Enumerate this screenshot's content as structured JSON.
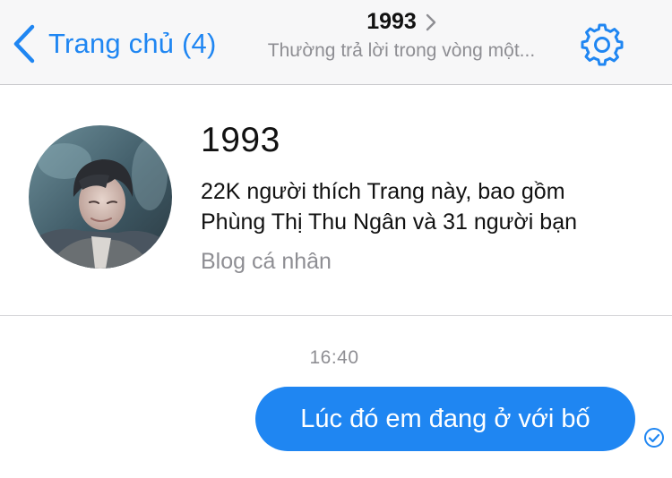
{
  "navbar": {
    "back_label": "Trang chủ (4)",
    "title": "1993",
    "subtitle": "Thường trả lời trong vòng một...",
    "icons": {
      "back": "chevron-left-icon",
      "title_chevron": "chevron-right-icon",
      "settings": "gear-icon"
    }
  },
  "page_card": {
    "name": "1993",
    "likes_line1": "22K người thích Trang này, bao gồm",
    "likes_line2": "Phùng Thị Thu Ngân và 31 người bạn",
    "category": "Blog cá nhân"
  },
  "conversation": {
    "timestamp": "16:40",
    "messages": [
      {
        "text": "Lúc đó em đang ở với bố",
        "sender": "me",
        "status_icon": "seen-check-icon"
      }
    ]
  },
  "colors": {
    "accent": "#1f86f2",
    "nav_background": "#f7f7f8",
    "secondary_text": "#8e8e93",
    "bubble_text": "#ffffff"
  }
}
